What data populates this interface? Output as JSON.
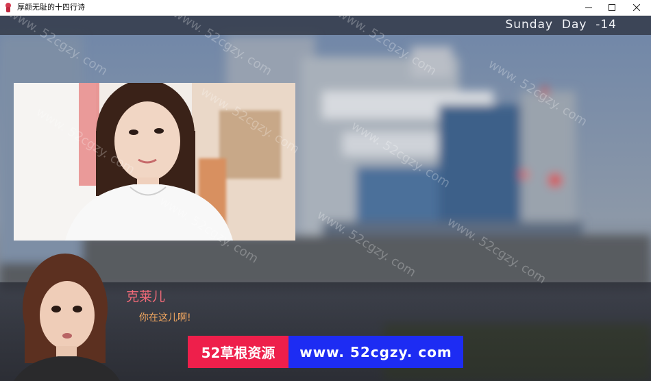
{
  "window": {
    "title": "厚颜无耻的十四行诗",
    "icon": "app-icon",
    "controls": [
      "minimize-icon",
      "maximize-icon",
      "close-icon"
    ]
  },
  "hud": {
    "day_text": "Sunday  Day  -14"
  },
  "dialogue": {
    "speaker": "克莱儿",
    "text": "你在这儿啊!"
  },
  "banner": {
    "left_text": "52草根资源",
    "right_text": "www. 52cgzy. com",
    "left_color": "#ee1f4b",
    "right_color": "#1d2cf3"
  },
  "watermark": {
    "text": "www. 52cgzy. com"
  },
  "colors": {
    "speaker_name": "#f06a78",
    "dialogue_text": "#f4a860"
  }
}
